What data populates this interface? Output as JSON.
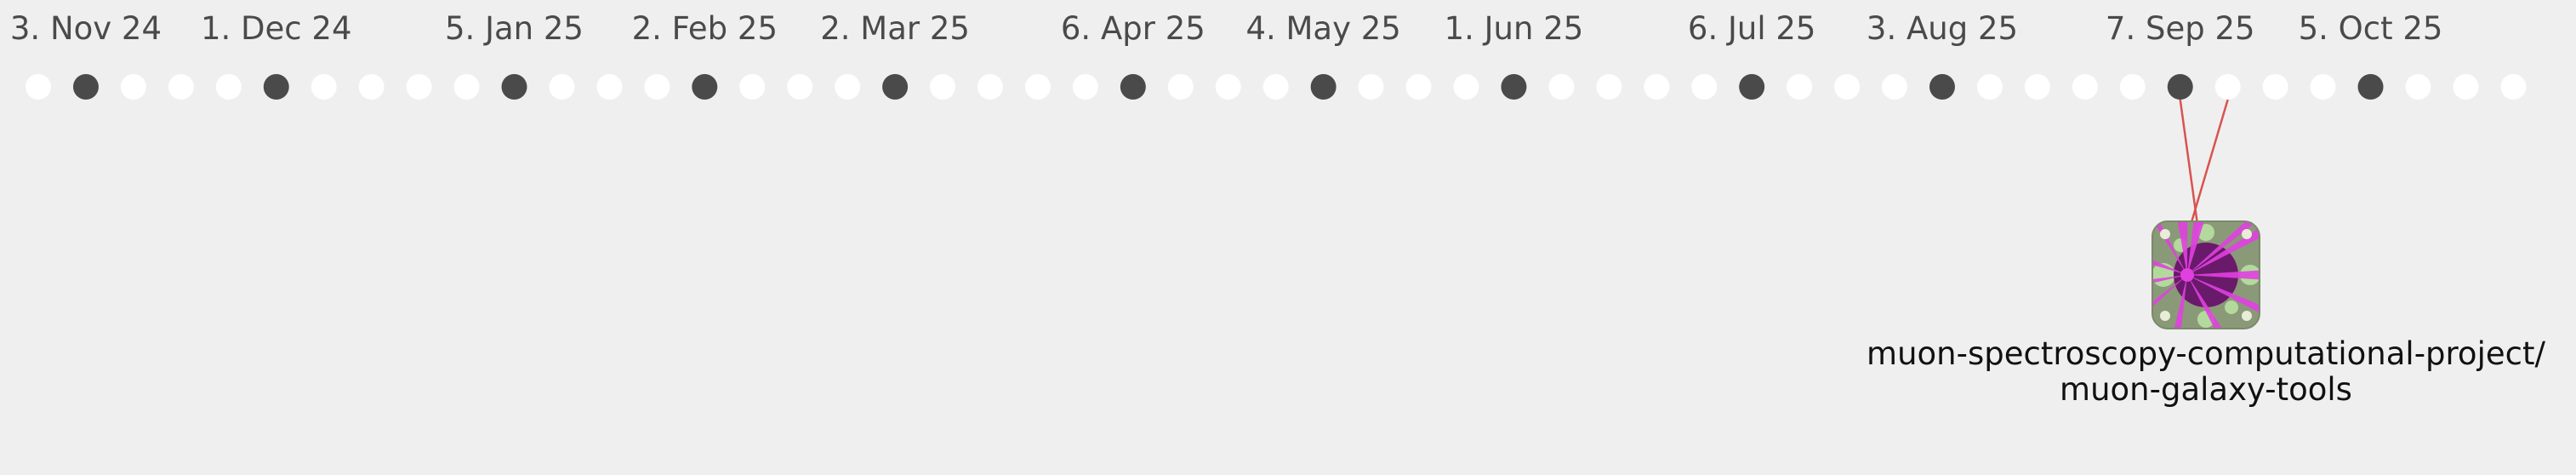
{
  "timeline": {
    "week_dot_count": 53,
    "highlighted_weeks": [
      1,
      5,
      10,
      14,
      18,
      23,
      27,
      31,
      36,
      40,
      45,
      49
    ],
    "date_labels": [
      {
        "text": "3. Nov 24",
        "week": 1
      },
      {
        "text": "1. Dec 24",
        "week": 5
      },
      {
        "text": "5. Jan 25",
        "week": 10
      },
      {
        "text": "2. Feb 25",
        "week": 14
      },
      {
        "text": "2. Mar 25",
        "week": 18
      },
      {
        "text": "6. Apr 25",
        "week": 23
      },
      {
        "text": "4. May 25",
        "week": 27
      },
      {
        "text": "1. Jun 25",
        "week": 31
      },
      {
        "text": "6. Jul 25",
        "week": 36
      },
      {
        "text": "3. Aug 25",
        "week": 40
      },
      {
        "text": "7. Sep 25",
        "week": 45
      },
      {
        "text": "5. Oct 25",
        "week": 49
      }
    ],
    "colors": {
      "background": "#efefef",
      "dot_empty": "#ffffff",
      "dot_filled": "#4a4a4a",
      "date_text": "#4a4a4a",
      "connector": "#d9534f"
    }
  },
  "repos": [
    {
      "name_line1": "muon-spectroscopy-computational-project/",
      "name_line2": "muon-galaxy-tools",
      "weeks": [
        45,
        46
      ],
      "avatar_icon": "repo-avatar-icon",
      "avatar_colors": {
        "base": "#8a9a78",
        "accent": "#e040e0",
        "dark": "#6a1a6a",
        "light": "#b8e0a0"
      }
    }
  ]
}
